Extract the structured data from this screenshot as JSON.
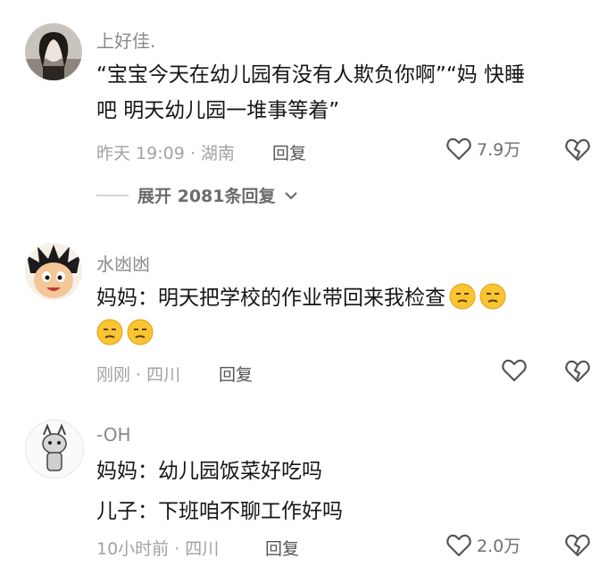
{
  "comments": [
    {
      "username": "上好佳.",
      "lines": [
        "“宝宝今天在幼儿园有没有人欺负你啊”“妈 快睡",
        "吧 明天幼儿园一堆事等着”"
      ],
      "time_location": "昨天 19:09 · 湖南",
      "reply_label": "回复",
      "likes": "7.9万",
      "expand_label": "展开 2081条回复"
    },
    {
      "username": "水凼凼",
      "lines": [
        "妈妈：明天把学校的作业带回来我检查",
        ""
      ],
      "emoji": "smug-face",
      "time_location": "刚刚 · 四川",
      "reply_label": "回复",
      "likes": ""
    },
    {
      "username": "-OH",
      "lines": [
        "妈妈：幼儿园饭菜好吃吗",
        "儿子：下班咱不聊工作好吗"
      ],
      "time_location": "10小时前 · 四川",
      "reply_label": "回复",
      "likes": "2.0万"
    }
  ],
  "icons": {
    "like": "heart-outline-icon",
    "dislike": "broken-heart-icon",
    "expand": "chevron-down-icon"
  }
}
